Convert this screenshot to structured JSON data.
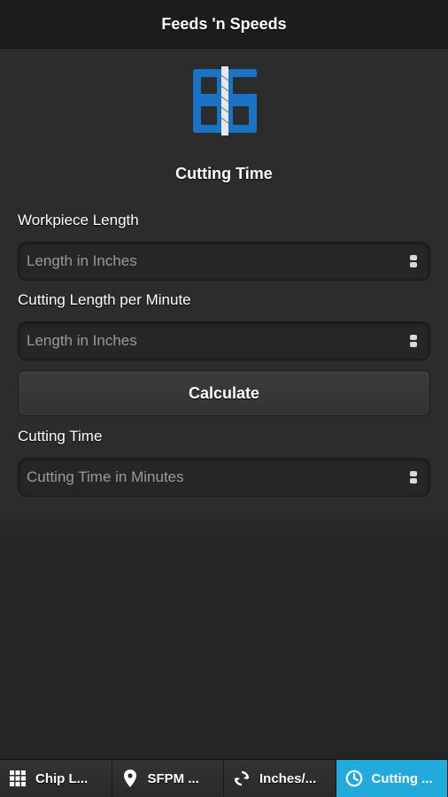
{
  "header": {
    "title": "Feeds 'n Speeds"
  },
  "colors": {
    "accent": "#22aadd",
    "logo_blue": "#1a73c4"
  },
  "logo": {
    "icon": "fs-logo-icon"
  },
  "main": {
    "section_title": "Cutting Time",
    "fields": [
      {
        "label": "Workpiece Length",
        "placeholder": "Length in Inches",
        "value": ""
      },
      {
        "label": "Cutting Length per Minute",
        "placeholder": "Length in Inches",
        "value": ""
      }
    ],
    "calculate_label": "Calculate",
    "result": {
      "label": "Cutting Time",
      "placeholder": "Cutting Time in Minutes",
      "value": ""
    }
  },
  "tabs": [
    {
      "label": "Chip L...",
      "icon": "grid-icon",
      "active": false
    },
    {
      "label": "SFPM ...",
      "icon": "map-pin-icon",
      "active": false
    },
    {
      "label": "Inches/...",
      "icon": "refresh-icon",
      "active": false
    },
    {
      "label": "Cutting ...",
      "icon": "clock-icon",
      "active": true
    }
  ]
}
